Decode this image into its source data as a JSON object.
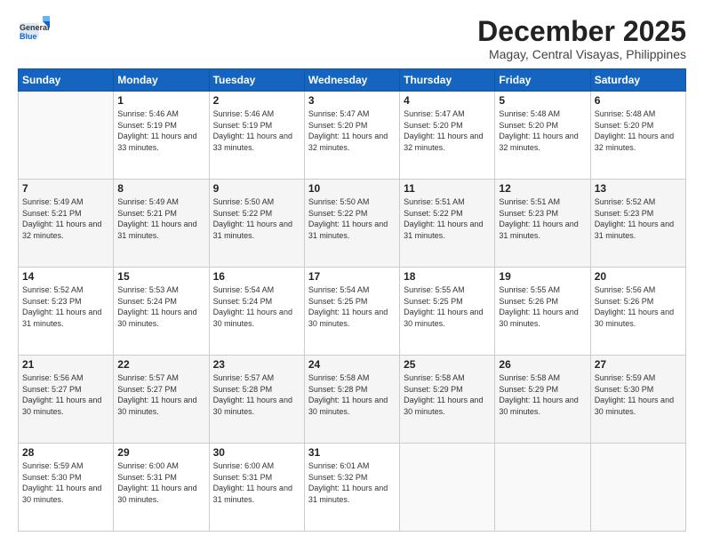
{
  "logo": {
    "general": "General",
    "blue": "Blue"
  },
  "header": {
    "title": "December 2025",
    "subtitle": "Magay, Central Visayas, Philippines"
  },
  "weekdays": [
    "Sunday",
    "Monday",
    "Tuesday",
    "Wednesday",
    "Thursday",
    "Friday",
    "Saturday"
  ],
  "weeks": [
    [
      {
        "day": "",
        "empty": true
      },
      {
        "day": "1",
        "rise": "5:46 AM",
        "set": "5:19 PM",
        "hours": "11 hours and 33 minutes."
      },
      {
        "day": "2",
        "rise": "5:46 AM",
        "set": "5:19 PM",
        "hours": "11 hours and 33 minutes."
      },
      {
        "day": "3",
        "rise": "5:47 AM",
        "set": "5:20 PM",
        "hours": "11 hours and 32 minutes."
      },
      {
        "day": "4",
        "rise": "5:47 AM",
        "set": "5:20 PM",
        "hours": "11 hours and 32 minutes."
      },
      {
        "day": "5",
        "rise": "5:48 AM",
        "set": "5:20 PM",
        "hours": "11 hours and 32 minutes."
      },
      {
        "day": "6",
        "rise": "5:48 AM",
        "set": "5:20 PM",
        "hours": "11 hours and 32 minutes."
      }
    ],
    [
      {
        "day": "7",
        "rise": "5:49 AM",
        "set": "5:21 PM",
        "hours": "11 hours and 32 minutes."
      },
      {
        "day": "8",
        "rise": "5:49 AM",
        "set": "5:21 PM",
        "hours": "11 hours and 31 minutes."
      },
      {
        "day": "9",
        "rise": "5:50 AM",
        "set": "5:22 PM",
        "hours": "11 hours and 31 minutes."
      },
      {
        "day": "10",
        "rise": "5:50 AM",
        "set": "5:22 PM",
        "hours": "11 hours and 31 minutes."
      },
      {
        "day": "11",
        "rise": "5:51 AM",
        "set": "5:22 PM",
        "hours": "11 hours and 31 minutes."
      },
      {
        "day": "12",
        "rise": "5:51 AM",
        "set": "5:23 PM",
        "hours": "11 hours and 31 minutes."
      },
      {
        "day": "13",
        "rise": "5:52 AM",
        "set": "5:23 PM",
        "hours": "11 hours and 31 minutes."
      }
    ],
    [
      {
        "day": "14",
        "rise": "5:52 AM",
        "set": "5:23 PM",
        "hours": "11 hours and 31 minutes."
      },
      {
        "day": "15",
        "rise": "5:53 AM",
        "set": "5:24 PM",
        "hours": "11 hours and 30 minutes."
      },
      {
        "day": "16",
        "rise": "5:54 AM",
        "set": "5:24 PM",
        "hours": "11 hours and 30 minutes."
      },
      {
        "day": "17",
        "rise": "5:54 AM",
        "set": "5:25 PM",
        "hours": "11 hours and 30 minutes."
      },
      {
        "day": "18",
        "rise": "5:55 AM",
        "set": "5:25 PM",
        "hours": "11 hours and 30 minutes."
      },
      {
        "day": "19",
        "rise": "5:55 AM",
        "set": "5:26 PM",
        "hours": "11 hours and 30 minutes."
      },
      {
        "day": "20",
        "rise": "5:56 AM",
        "set": "5:26 PM",
        "hours": "11 hours and 30 minutes."
      }
    ],
    [
      {
        "day": "21",
        "rise": "5:56 AM",
        "set": "5:27 PM",
        "hours": "11 hours and 30 minutes."
      },
      {
        "day": "22",
        "rise": "5:57 AM",
        "set": "5:27 PM",
        "hours": "11 hours and 30 minutes."
      },
      {
        "day": "23",
        "rise": "5:57 AM",
        "set": "5:28 PM",
        "hours": "11 hours and 30 minutes."
      },
      {
        "day": "24",
        "rise": "5:58 AM",
        "set": "5:28 PM",
        "hours": "11 hours and 30 minutes."
      },
      {
        "day": "25",
        "rise": "5:58 AM",
        "set": "5:29 PM",
        "hours": "11 hours and 30 minutes."
      },
      {
        "day": "26",
        "rise": "5:58 AM",
        "set": "5:29 PM",
        "hours": "11 hours and 30 minutes."
      },
      {
        "day": "27",
        "rise": "5:59 AM",
        "set": "5:30 PM",
        "hours": "11 hours and 30 minutes."
      }
    ],
    [
      {
        "day": "28",
        "rise": "5:59 AM",
        "set": "5:30 PM",
        "hours": "11 hours and 30 minutes."
      },
      {
        "day": "29",
        "rise": "6:00 AM",
        "set": "5:31 PM",
        "hours": "11 hours and 30 minutes."
      },
      {
        "day": "30",
        "rise": "6:00 AM",
        "set": "5:31 PM",
        "hours": "11 hours and 31 minutes."
      },
      {
        "day": "31",
        "rise": "6:01 AM",
        "set": "5:32 PM",
        "hours": "11 hours and 31 minutes."
      },
      {
        "day": "",
        "empty": true
      },
      {
        "day": "",
        "empty": true
      },
      {
        "day": "",
        "empty": true
      }
    ]
  ],
  "labels": {
    "sunrise": "Sunrise:",
    "sunset": "Sunset:",
    "daylight": "Daylight:"
  }
}
